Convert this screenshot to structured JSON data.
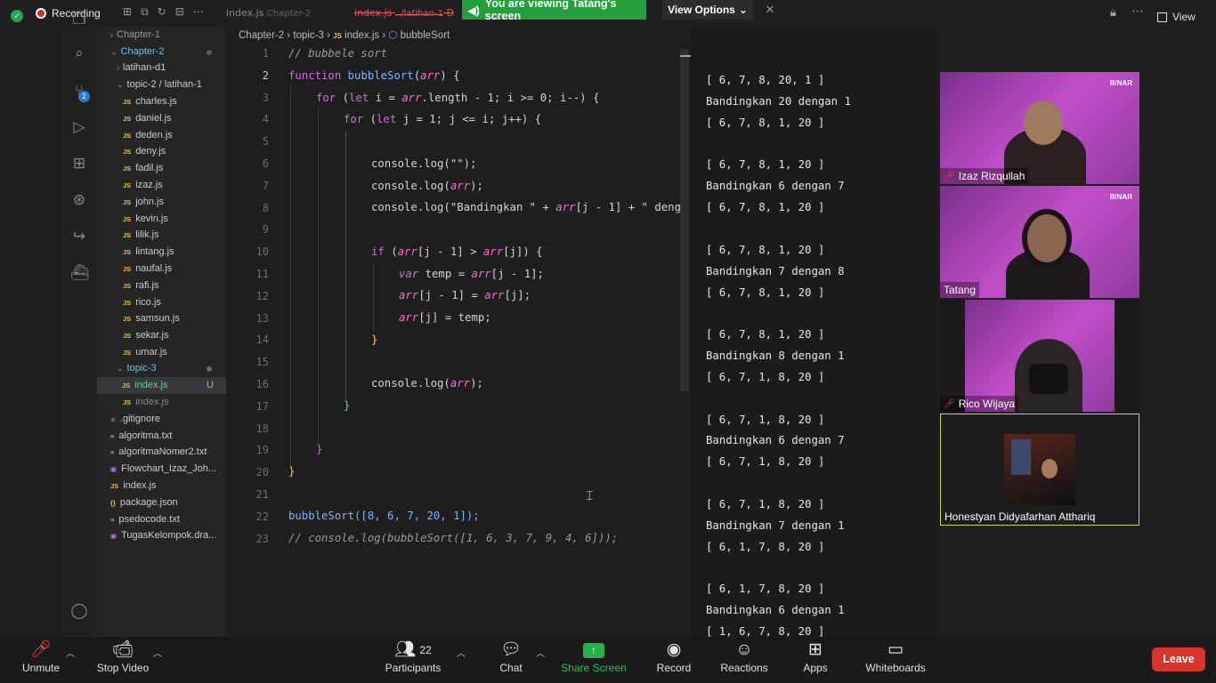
{
  "zoom": {
    "recording_label": "Recording",
    "banner_text": "You are viewing Tatang's screen",
    "view_options_label": "View Options",
    "view_label": "View",
    "bottom_bar": {
      "unmute": "Unmute",
      "stop_video": "Stop Video",
      "participants": "Participants",
      "participants_count": "22",
      "chat": "Chat",
      "share_screen": "Share Screen",
      "record": "Record",
      "reactions": "Reactions",
      "apps": "Apps",
      "whiteboards": "Whiteboards",
      "leave": "Leave"
    },
    "participants": [
      {
        "name": "Izaz Rizqullah",
        "muted": true
      },
      {
        "name": "Tatang",
        "muted": false
      },
      {
        "name": "Rico Wijaya",
        "muted": true
      },
      {
        "name": "Honestyan Didyafarhan Atthariq",
        "muted": false
      }
    ],
    "tile_brand": "BINAR",
    "accent_green": "#23a03c",
    "leave_red": "#d9342b"
  },
  "vscode": {
    "tabs": [
      {
        "label": "index.js",
        "path": "Chapter-2"
      },
      {
        "label": "index.js",
        "path": "../latihan-1",
        "flag": "D"
      }
    ],
    "breadcrumb": [
      "Chapter-2",
      "topic-3",
      "index.js",
      "bubbleSort"
    ],
    "explorer": {
      "folders": [
        "Chapter-1",
        "Chapter-2",
        "latihan-d1",
        "topic-2 / latihan-1",
        "topic-3"
      ],
      "topic2_files": [
        "charles.js",
        "daniel.js",
        "deden.js",
        "deny.js",
        "fadil.js",
        "izaz.js",
        "john.js",
        "kevin.js",
        "lilik.js",
        "lintang.js",
        "naufal.js",
        "rafi.js",
        "rico.js",
        "samsun.js",
        "sekar.js",
        "umar.js"
      ],
      "topic3_active_file": "index.js",
      "topic3_active_status": "U",
      "extra_files": [
        "index.js",
        ".gitignore",
        "algoritma.txt",
        "algoritmaNomer2.txt",
        "Flowchart_Izaz_Joh...",
        "index.js",
        "package.json",
        "psedocode.txt",
        "TugasKelompok.dra..."
      ],
      "git_badge": "2"
    },
    "line_numbers": [
      "1",
      "2",
      "3",
      "4",
      "5",
      "6",
      "7",
      "8",
      "9",
      "10",
      "11",
      "12",
      "13",
      "14",
      "15",
      "16",
      "17",
      "18",
      "19",
      "20",
      "21",
      "22",
      "23"
    ],
    "code": {
      "l1": "// bubbele sort",
      "l2_kw": "function",
      "l2_fn": "bubbleSort",
      "l2_rest": "(",
      "l2_param": "arr",
      "l2_end": ") {",
      "l3_a": "for",
      "l3_b": " (",
      "l3_c": "let",
      "l3_d": " i = ",
      "l3_e": "arr",
      "l3_f": ".length - 1; i >= 0; i--) {",
      "l4_a": "for",
      "l4_b": " (",
      "l4_c": "let",
      "l4_d": " j = 1; j <= i; j++) {",
      "l6": "console.log(\"\");",
      "l7_a": "console.log(",
      "l7_b": "arr",
      "l7_c": ");",
      "l8_a": "console.log(\"Bandingkan \" + ",
      "l8_b": "arr",
      "l8_c": "[j - 1] + \" deng",
      "l10_a": "if",
      "l10_b": " (",
      "l10_c": "arr",
      "l10_d": "[j - 1] > ",
      "l10_e": "arr",
      "l10_f": "[j]) {",
      "l11_a": "var",
      "l11_b": " temp = ",
      "l11_c": "arr",
      "l11_d": "[j - 1];",
      "l12_a": "arr",
      "l12_b": "[j - 1] = ",
      "l12_c": "arr",
      "l12_d": "[j];",
      "l13_a": "arr",
      "l13_b": "[j] = temp;",
      "l14": "}",
      "l16_a": "console.log(",
      "l16_b": "arr",
      "l16_c": ");",
      "l17": "}",
      "l19": "}",
      "l20": "}",
      "l22": "bubbleSort([8, 6, 7, 20, 1]);",
      "l23": "// console.log(bubbleSort([1, 6, 3, 7, 9, 4, 6]));"
    },
    "console_output": [
      "[ 6, 7, 8, 20, 1 ]",
      "Bandingkan 20 dengan 1",
      "[ 6, 7, 8, 1, 20 ]",
      "",
      "[ 6, 7, 8, 1, 20 ]",
      "Bandingkan 6 dengan 7",
      "[ 6, 7, 8, 1, 20 ]",
      "",
      "[ 6, 7, 8, 1, 20 ]",
      "Bandingkan 7 dengan 8",
      "[ 6, 7, 8, 1, 20 ]",
      "",
      "[ 6, 7, 8, 1, 20 ]",
      "Bandingkan 8 dengan 1",
      "[ 6, 7, 1, 8, 20 ]",
      "",
      "[ 6, 7, 1, 8, 20 ]",
      "Bandingkan 6 dengan 7",
      "[ 6, 7, 1, 8, 20 ]",
      "",
      "[ 6, 7, 1, 8, 20 ]",
      "Bandingkan 7 dengan 1",
      "[ 6, 1, 7, 8, 20 ]",
      "",
      "[ 6, 1, 7, 8, 20 ]",
      "Bandingkan 6 dengan 1",
      "[ 1, 6, 7, 8, 20 ]"
    ]
  }
}
